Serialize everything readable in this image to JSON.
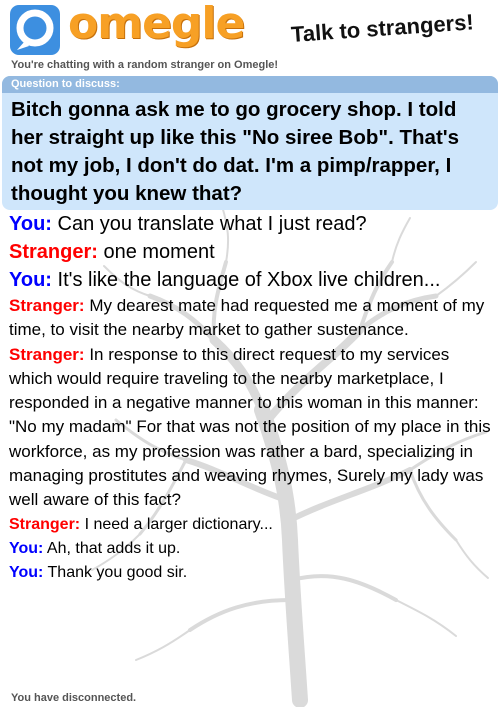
{
  "header": {
    "logo_text": "omegle",
    "tagline": "Talk to strangers!"
  },
  "intro": "You're chatting with a random stranger on Omegle!",
  "question": {
    "label": "Question to discuss:",
    "text": "Bitch gonna ask me to go grocery shop. I told her straight up like this \"No siree Bob\". That's not my job, I don't do dat. I'm a pimp/rapper, I thought you knew that?"
  },
  "messages": [
    {
      "speaker": "You:",
      "text": "Can you translate what I just read?"
    },
    {
      "speaker": "Stranger:",
      "text": "one moment"
    },
    {
      "speaker": "You:",
      "text": "It's like the language of Xbox live children..."
    },
    {
      "speaker": "Stranger:",
      "text": "My dearest mate had requested me a moment of my time, to visit the nearby market to gather sustenance."
    },
    {
      "speaker": "Stranger:",
      "text": "In response to this direct request to my services which would require traveling to the nearby marketplace, I responded in a negative manner to this woman in this manner: \"No my madam\" For that was not the position of my place in this workforce, as my profession was rather a bard, specializing in managing prostitutes and weaving rhymes, Surely my lady was well aware of this fact?"
    },
    {
      "speaker": "Stranger:",
      "text": "I need a larger dictionary..."
    },
    {
      "speaker": "You:",
      "text": "Ah, that adds it up."
    },
    {
      "speaker": "You:",
      "text": "Thank you good sir."
    }
  ],
  "status": "You have disconnected.",
  "colors": {
    "you": "#0000ff",
    "stranger": "#ff0000",
    "brand_orange": "#f7a025",
    "brand_blue": "#3d8fe0",
    "question_bg": "#cfe6fb",
    "question_header": "#93b9e0"
  }
}
